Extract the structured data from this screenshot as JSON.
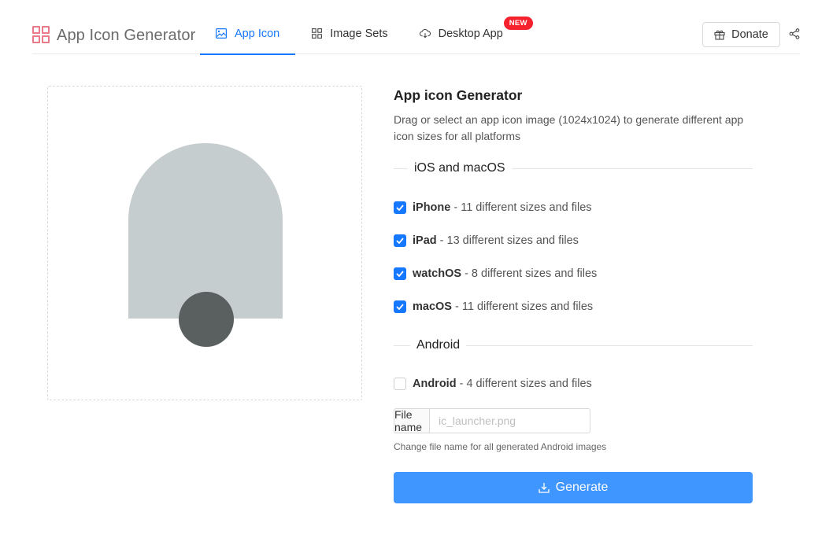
{
  "header": {
    "app_title": "App Icon Generator",
    "nav": [
      {
        "label": "App Icon",
        "icon": "image-icon",
        "active": true
      },
      {
        "label": "Image Sets",
        "icon": "grid-icon",
        "active": false
      },
      {
        "label": "Desktop App",
        "icon": "cloud-download-icon",
        "active": false,
        "badge": "NEW"
      }
    ],
    "donate_label": "Donate",
    "share_icon": "share-icon"
  },
  "colors": {
    "accent": "#1677ff",
    "button": "#4096ff",
    "badge": "#f5222d",
    "placeholder_shape": "#c6cdcf",
    "placeholder_circle": "#5a605f",
    "logo": "#e87a8a"
  },
  "panel": {
    "title": "App icon Generator",
    "description": "Drag or select an app icon image (1024x1024) to generate different app icon sizes for all platforms",
    "ios_section": {
      "label": "iOS and macOS",
      "options": [
        {
          "name": "iPhone",
          "detail": " - 11 different sizes and files",
          "checked": true
        },
        {
          "name": "iPad",
          "detail": " - 13 different sizes and files",
          "checked": true
        },
        {
          "name": "watchOS",
          "detail": " - 8 different sizes and files",
          "checked": true
        },
        {
          "name": "macOS",
          "detail": " - 11 different sizes and files",
          "checked": true
        }
      ]
    },
    "android_section": {
      "label": "Android",
      "options": [
        {
          "name": "Android",
          "detail": " - 4 different sizes and files",
          "checked": false
        }
      ],
      "file_name_label": "File name",
      "file_name_placeholder": "ic_launcher.png",
      "file_name_value": "",
      "hint": "Change file name for all generated Android images"
    },
    "generate_label": "Generate"
  }
}
